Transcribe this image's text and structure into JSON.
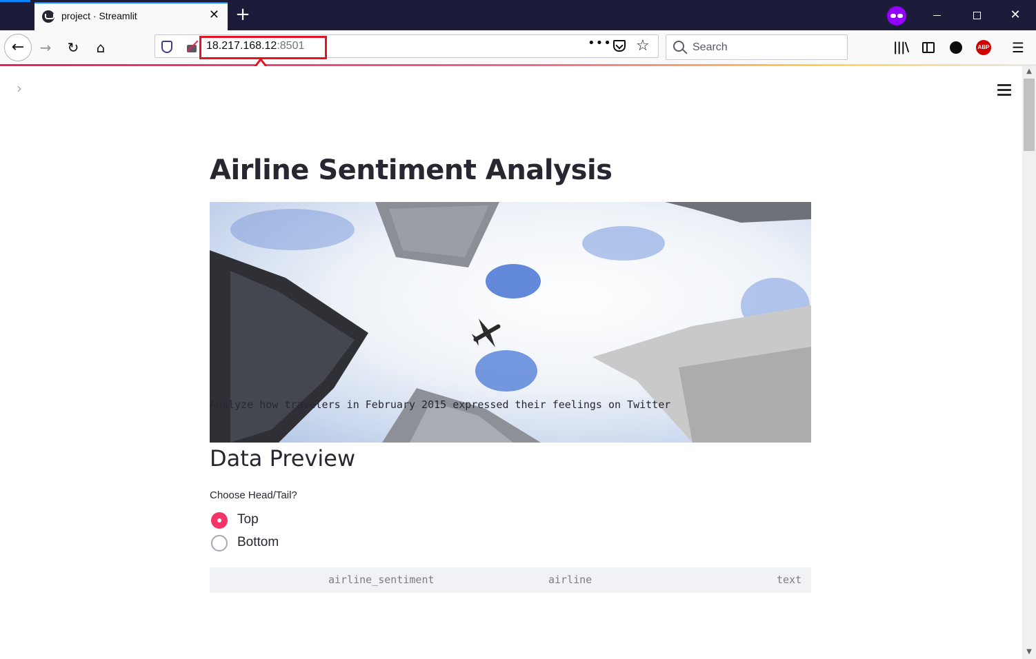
{
  "browser": {
    "tab_title": "project · Streamlit",
    "tab_close": "✕",
    "new_tab": "+",
    "url_host": "18.217.168.12",
    "url_port": ":8501",
    "page_actions": "•••",
    "search_placeholder": "Search",
    "abp_label": "ABP",
    "accent_color": "#0a84ff",
    "annotation_color": "#e3131f"
  },
  "icons": [
    "back-arrow-icon",
    "forward-arrow-icon",
    "reload-icon",
    "home-icon",
    "tracking-shield-icon",
    "insecure-lock-icon",
    "pocket-icon",
    "bookmark-star-icon",
    "search-icon",
    "library-icon",
    "sidebar-icon",
    "account-icon",
    "adblock-icon",
    "menu-icon",
    "private-browsing-icon"
  ],
  "app": {
    "title": "Airline Sentiment Analysis",
    "caption": "Analyze how travelers in February 2015 expressed their feelings on Twitter",
    "section_title": "Data Preview",
    "radio": {
      "label": "Choose Head/Tail?",
      "options": [
        "Top",
        "Bottom"
      ],
      "selected": "Top"
    },
    "table": {
      "columns": [
        "airline_sentiment",
        "airline",
        "text"
      ]
    },
    "primary_color": "#f63366"
  }
}
